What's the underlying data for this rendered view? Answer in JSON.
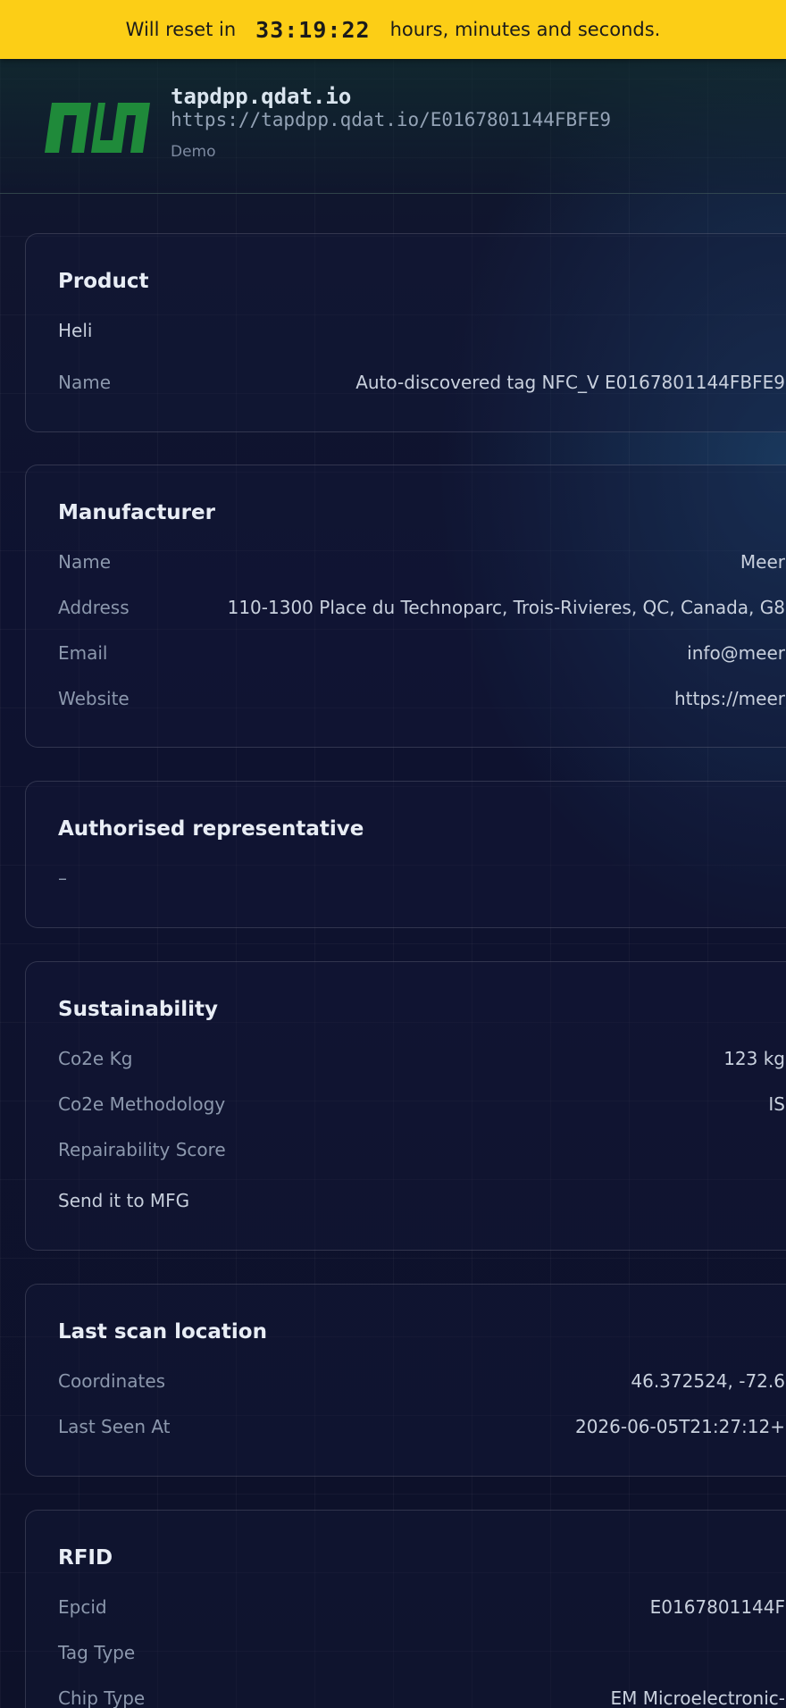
{
  "banner": {
    "prefix": "Will reset in",
    "timer": "33:19:22",
    "suffix": "hours, minutes and seconds.",
    "background_color": "#fcce16"
  },
  "header": {
    "logo_icon": "qdat-logo-icon",
    "logo_color": "#1f8a3a",
    "title": "tapdpp.qdat.io",
    "url": "https://tapdpp.qdat.io/E0167801144FBFE9",
    "tag": "Demo"
  },
  "product": {
    "title": "Product",
    "subtitle": "Heli",
    "name_label": "Name",
    "name_value": "Auto-discovered tag NFC_V E0167801144FBFE9"
  },
  "manufacturer": {
    "title": "Manufacturer",
    "rows": [
      {
        "label": "Name",
        "value": "Meer"
      },
      {
        "label": "Address",
        "value": "110-1300 Place du Technoparc, Trois-Rivieres, QC, Canada, G8"
      },
      {
        "label": "Email",
        "value": "info@meer"
      },
      {
        "label": "Website",
        "value": "https://meer"
      }
    ]
  },
  "authorised_representative": {
    "title": "Authorised representative",
    "value": "–"
  },
  "sustainability": {
    "title": "Sustainability",
    "rows": [
      {
        "label": "Co2e Kg",
        "value": "123 kg"
      },
      {
        "label": "Co2e Methodology",
        "value": "IS"
      },
      {
        "label": "Repairability Score",
        "value": ""
      }
    ],
    "note": "Send it to MFG"
  },
  "last_scan": {
    "title": "Last scan location",
    "rows": [
      {
        "label": "Coordinates",
        "value": "46.372524, -72.6"
      },
      {
        "label": "Last Seen At",
        "value": "2026-06-05T21:27:12+"
      }
    ]
  },
  "rfid": {
    "title": "RFID",
    "rows": [
      {
        "label": "Epcid",
        "value": "E0167801144F"
      },
      {
        "label": "Tag Type",
        "value": ""
      },
      {
        "label": "Chip Type",
        "value": "EM Microelectronic-"
      }
    ]
  }
}
